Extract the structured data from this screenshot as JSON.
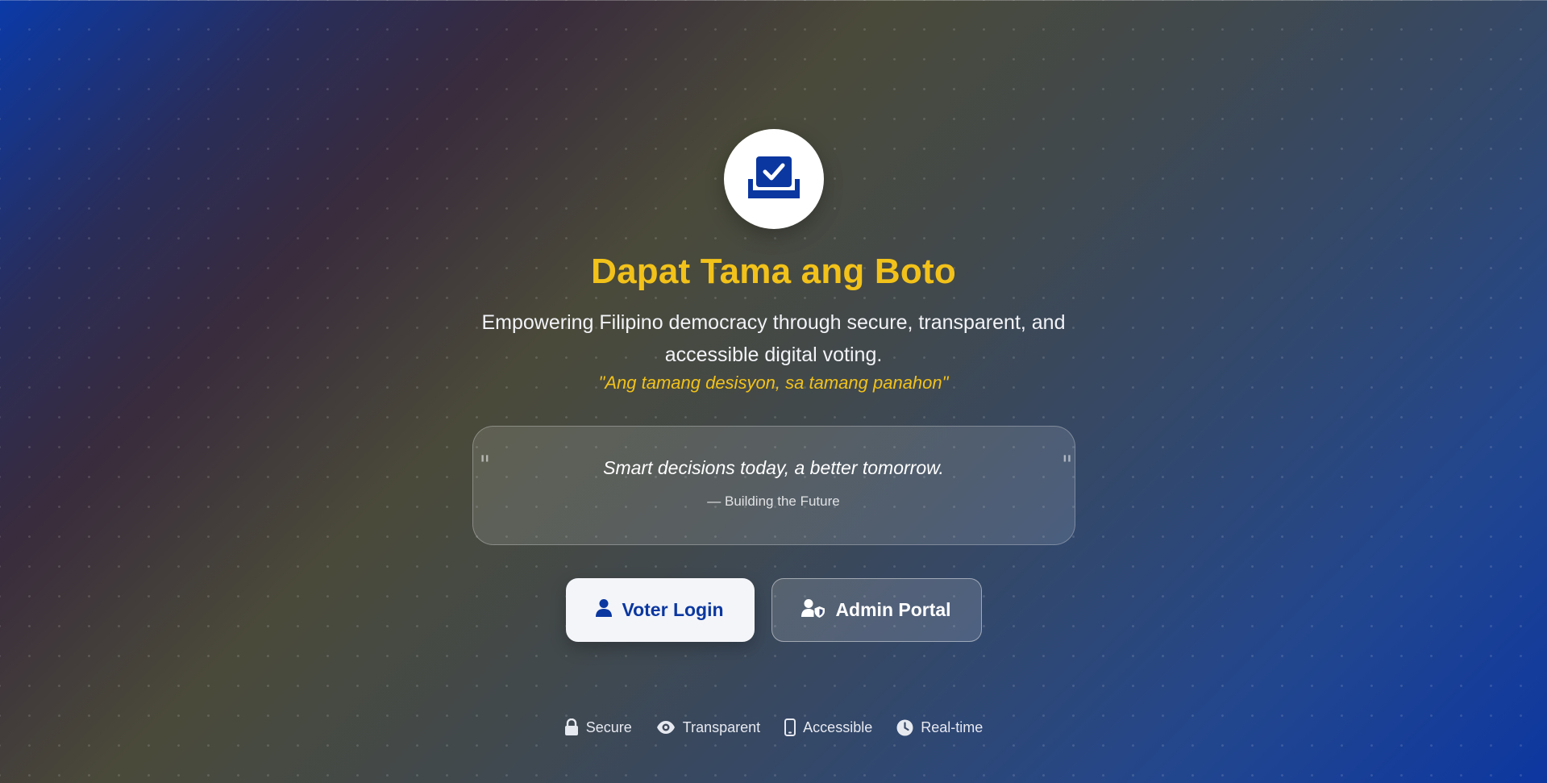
{
  "app": {
    "title": "Dapat Tama ang Boto",
    "subtitle": "Empowering Filipino democracy through secure, transparent, and accessible digital voting.",
    "tagline": "\"Ang tamang desisyon, sa tamang panahon\"",
    "logo_icon": "ballot-check-icon"
  },
  "quote": {
    "text": "Smart decisions today, a better tomorrow.",
    "author": "— Building the Future",
    "open_mark": "\"",
    "close_mark": "\""
  },
  "buttons": {
    "voter_login": {
      "label": "Voter Login",
      "icon": "user-icon"
    },
    "admin_portal": {
      "label": "Admin Portal",
      "icon": "user-shield-icon"
    }
  },
  "features": [
    {
      "label": "Secure",
      "icon": "lock-icon"
    },
    {
      "label": "Transparent",
      "icon": "eye-icon"
    },
    {
      "label": "Accessible",
      "icon": "mobile-icon"
    },
    {
      "label": "Real-time",
      "icon": "clock-icon"
    }
  ],
  "colors": {
    "accent_yellow": "#f2c21a",
    "brand_blue": "#0b37a0",
    "text_light": "#f2f3f7"
  }
}
